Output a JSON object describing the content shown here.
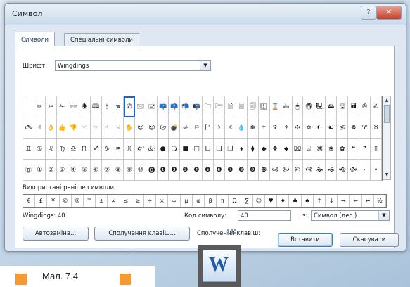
{
  "dialog": {
    "title": "Символ",
    "close_glyph": "✕",
    "help_glyph": "?"
  },
  "tabs": [
    {
      "label": "Символи",
      "active": true
    },
    {
      "label": "Спеціальні символи",
      "active": false
    }
  ],
  "font": {
    "label": "Шрифт:",
    "value": "Wingdings"
  },
  "symbols": {
    "rows": [
      [
        "",
        "✏",
        "✂",
        "✁",
        "👓",
        "🕭",
        "🕮",
        "🕯",
        "🕿",
        "✆",
        "🖂",
        "🖃",
        "📪",
        "📫",
        "📬",
        "📭",
        "🗀",
        "🗁",
        "🗎",
        "🗏",
        "🗐",
        "🗄",
        "⌛",
        "🖮",
        "🖰",
        "🖲",
        "🖳",
        "🖴",
        "🖫",
        "🖬",
        "✇",
        "✍"
      ],
      [
        "🖎",
        "✌",
        "👌",
        "👍",
        "👎",
        "☜",
        "☞",
        "☝",
        "☟",
        "✋",
        "☺",
        "😐",
        "☹",
        "💣",
        "☠",
        "⚐",
        "🏱",
        "✈",
        "☼",
        "💧",
        "❄",
        "🕆",
        "✞",
        "🕈",
        "✠",
        "✡",
        "☪",
        "☯",
        "ॐ",
        "☸",
        "♈",
        "♉"
      ],
      [
        "♊",
        "♋",
        "♌",
        "♍",
        "♎",
        "♏",
        "♐",
        "♑",
        "♒",
        "♓",
        "🙰",
        "🙵",
        "●",
        "🔾",
        "■",
        "□",
        "🞐",
        "❑",
        "❒",
        "⬧",
        "⧫",
        "◆",
        "❖",
        "⬥",
        "⌧",
        "⍓",
        "⌘",
        "❀",
        "✿",
        "❝",
        "❞",
        "▯"
      ],
      [
        "⓪",
        "①",
        "②",
        "③",
        "④",
        "⑤",
        "⑥",
        "⑦",
        "⑧",
        "⑨",
        "⑩",
        "⓿",
        "❶",
        "❷",
        "❸",
        "❹",
        "❺",
        "❻",
        "❼",
        "❽",
        "❾",
        "❿",
        "🙢",
        "🙠",
        "🙡",
        "🙣",
        "🙞",
        "🙜",
        "🙝",
        "🙟",
        "·",
        "•"
      ]
    ],
    "selected_row": 0,
    "selected_col": 9
  },
  "recent": {
    "label": "Використані раніше символи:",
    "items": [
      "€",
      "£",
      "¥",
      "©",
      "®",
      "™",
      "±",
      "≠",
      "≤",
      "≥",
      "÷",
      "×",
      "∞",
      "µ",
      "α",
      "β",
      "π",
      "Ω",
      "∑",
      "☺",
      "♥",
      "♦",
      "♣",
      "♠",
      "↑",
      "↓",
      "→",
      "←",
      "↔",
      "½"
    ]
  },
  "status": {
    "font_code": "Wingdings: 40",
    "charcode_label": "Код символу:",
    "charcode_value": "40",
    "from_label": "з:",
    "from_value": "Символ (дес.)",
    "shortcut_text": "Сполучення клавіш:"
  },
  "buttons": {
    "autocorrect": "Автозаміна...",
    "shortcut": "Сполучення клавіш...",
    "insert": "Вставити",
    "cancel": "Скасувати"
  },
  "caption": "Мал. 7.4",
  "app_icon": "W"
}
